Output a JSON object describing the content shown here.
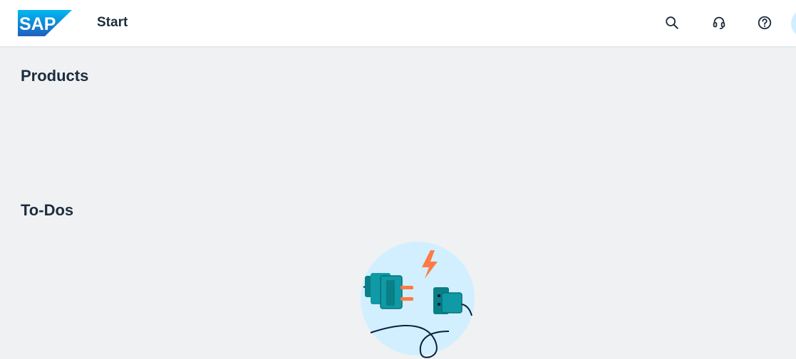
{
  "shellbar": {
    "logo_text": "SAP",
    "title": "Start",
    "actions": [
      {
        "icon": "search-icon"
      },
      {
        "icon": "headset-icon"
      },
      {
        "icon": "help-icon"
      }
    ]
  },
  "sections": {
    "products": {
      "title": "Products"
    },
    "todos": {
      "title": "To-Dos"
    }
  },
  "colors": {
    "brand_blue": "#0a6ed1",
    "background": "#eff1f3",
    "header_bg": "#ffffff",
    "text": "#1d2d3e",
    "illustration_circle": "#d1efff",
    "plug_teal": "#0f9aa5",
    "bolt_orange": "#ff7a45"
  }
}
